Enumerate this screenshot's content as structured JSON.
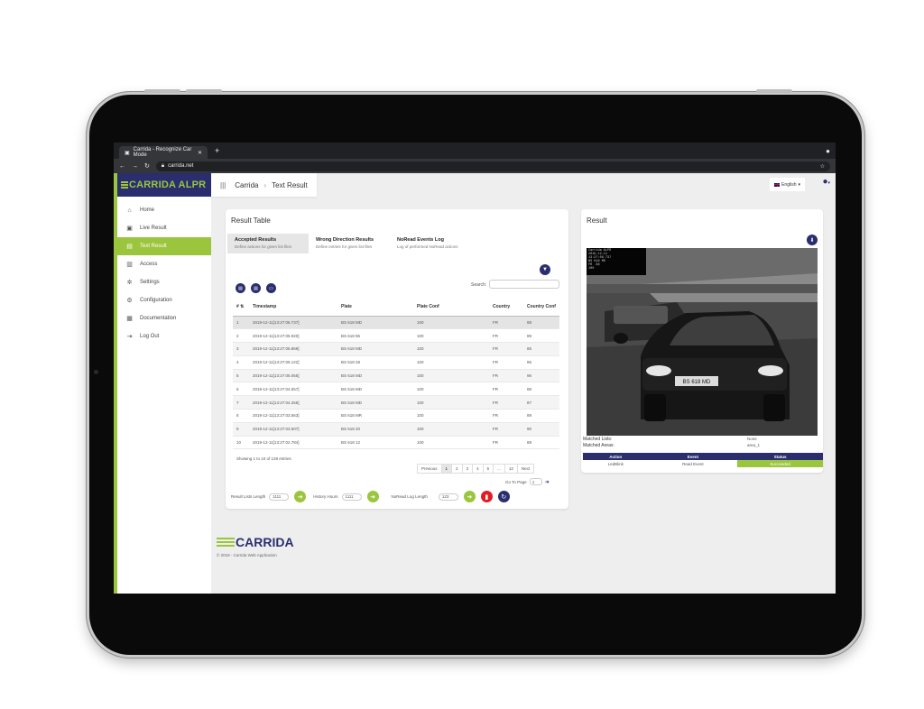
{
  "browser": {
    "tab_title": "Carrida - Recognize Car Mode",
    "url": "carrida.net"
  },
  "app": {
    "brand": "CARRIDA ALPR",
    "breadcrumb": [
      "Carrida",
      "Text Result"
    ],
    "language": "English",
    "colors": {
      "navy": "#2a2e6e",
      "green": "#9bc53d",
      "red": "#e31c23"
    }
  },
  "sidebar": {
    "items": [
      {
        "label": "Home",
        "icon": "home-icon"
      },
      {
        "label": "Live Result",
        "icon": "camera-icon"
      },
      {
        "label": "Text Result",
        "icon": "text-icon",
        "active": true
      },
      {
        "label": "Access",
        "icon": "printer-icon"
      },
      {
        "label": "Settings",
        "icon": "gear-icon"
      },
      {
        "label": "Configuration",
        "icon": "cogs-icon"
      },
      {
        "label": "Documentation",
        "icon": "book-icon"
      },
      {
        "label": "Log Out",
        "icon": "logout-icon"
      }
    ]
  },
  "result_table": {
    "title": "Result Table",
    "tabs": [
      {
        "title": "Accepted Results",
        "sub": "Define actions for given list files"
      },
      {
        "title": "Wrong Direction Results",
        "sub": "Define entries for given list files"
      },
      {
        "title": "NoRead Events Log",
        "sub": "Log of performed NoRead actions"
      }
    ],
    "search_label": "Search:",
    "columns": [
      "#",
      "Timestamp",
      "Plate",
      "Plate Conf",
      "Country",
      "Country Conf"
    ],
    "rows": [
      [
        "1",
        "2019-12-11[13:27:06.737]",
        "BS 618 MD",
        "100",
        "FR",
        "88"
      ],
      [
        "2",
        "2019-12-11[13:27:05.920]",
        "BS 618 86",
        "100",
        "FR",
        "89"
      ],
      [
        "3",
        "2019-12-11[13:27:05.869]",
        "BS 618 MD",
        "100",
        "FR",
        "85"
      ],
      [
        "4",
        "2019-12-11[13:27:05.122]",
        "BS 618 28",
        "100",
        "FR",
        "85"
      ],
      [
        "5",
        "2019-12-11[13:27:05.055]",
        "BS 618 MD",
        "100",
        "FR",
        "96"
      ],
      [
        "6",
        "2019-12-11[13:27:04.557]",
        "BS 618 MD",
        "100",
        "FR",
        "88"
      ],
      [
        "7",
        "2019-12-11[13:27:04.255]",
        "BS 618 MD",
        "100",
        "FR",
        "87"
      ],
      [
        "8",
        "2019-12-11[13:27:03.563]",
        "BS 618 MR",
        "100",
        "FR",
        "89"
      ],
      [
        "9",
        "2019-12-11[13:27:03.507]",
        "BS 618 20",
        "100",
        "FR",
        "90"
      ],
      [
        "10",
        "2019-12-11[13:27:02.784]",
        "BS 618 12",
        "100",
        "FR",
        "89"
      ]
    ],
    "showing": "Showing 1 to 10 of 128 entries",
    "pager": [
      "Previous",
      "1",
      "2",
      "3",
      "4",
      "5",
      "...",
      "12",
      "Next"
    ],
    "goto_label": "Go To Page",
    "goto_value": "1",
    "result_lists_label": "Result Lists Length",
    "result_lists_value": "1111",
    "history_label": "History Hours",
    "history_value": "1111",
    "noread_label": "NoRead Log Length",
    "noread_value": "123"
  },
  "result": {
    "title": "Result",
    "overlay_text": "Carrida ALPR\n2019-12-11\n13:27:06.737\nBS 618 MD\nFR  88\n100",
    "matched_lists_label": "Matched Lists:",
    "matched_lists_value": "None",
    "matched_areas_label": "Matched Areas:",
    "matched_areas_value": "area_1",
    "action_columns": [
      "Action",
      "Event",
      "Status"
    ],
    "action_row": [
      "LedBlink",
      "Read Event",
      "Succeeded"
    ],
    "plate_text": "BS 618 MD"
  },
  "footer": {
    "logo": "CARRIDA",
    "copyright": "© 2019 - Carrida Web Application"
  }
}
